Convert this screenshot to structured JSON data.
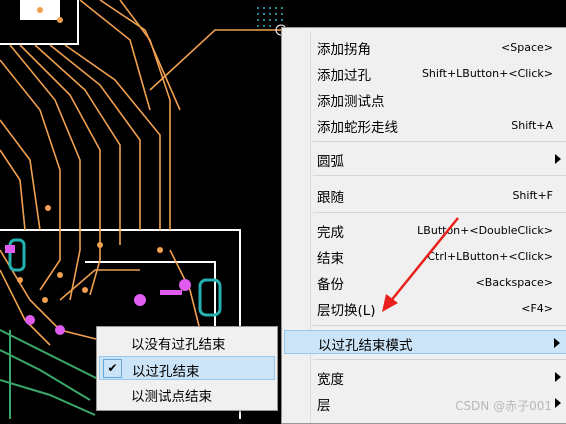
{
  "context_menu": {
    "items": [
      {
        "label": "添加拐角",
        "shortcut": "<Space>"
      },
      {
        "label": "添加过孔",
        "shortcut": "Shift+LButton+<Click>"
      },
      {
        "label": "添加测试点",
        "shortcut": ""
      },
      {
        "label": "添加蛇形走线",
        "shortcut": "Shift+A"
      },
      {
        "label": "圆弧",
        "shortcut": "",
        "submenu": true
      },
      {
        "label": "跟随",
        "shortcut": "Shift+F"
      },
      {
        "label": "完成",
        "shortcut": "LButton+<DoubleClick>"
      },
      {
        "label": "结束",
        "shortcut": "Ctrl+LButton+<Click>"
      },
      {
        "label": "备份",
        "shortcut": "<Backspace>"
      },
      {
        "label": "层切换(L)",
        "shortcut": "<F4>"
      },
      {
        "label": "以过孔结束模式",
        "shortcut": "",
        "submenu": true,
        "highlighted": true
      },
      {
        "label": "宽度",
        "shortcut": "",
        "submenu": true
      },
      {
        "label": "层",
        "shortcut": "",
        "submenu": true
      }
    ]
  },
  "submenu": {
    "items": [
      {
        "label": "以没有过孔结束",
        "checked": false
      },
      {
        "label": "以过孔结束",
        "checked": true
      },
      {
        "label": "以测试点结束",
        "checked": false
      }
    ],
    "check_glyph": "✔"
  },
  "watermark": "CSDN @赤子001",
  "colors": {
    "background": "#000000",
    "trace": "#f0a050",
    "via": "#e05cf0",
    "annotation_arrow": "#e8201c",
    "menu_highlight": "#cce4f7"
  }
}
